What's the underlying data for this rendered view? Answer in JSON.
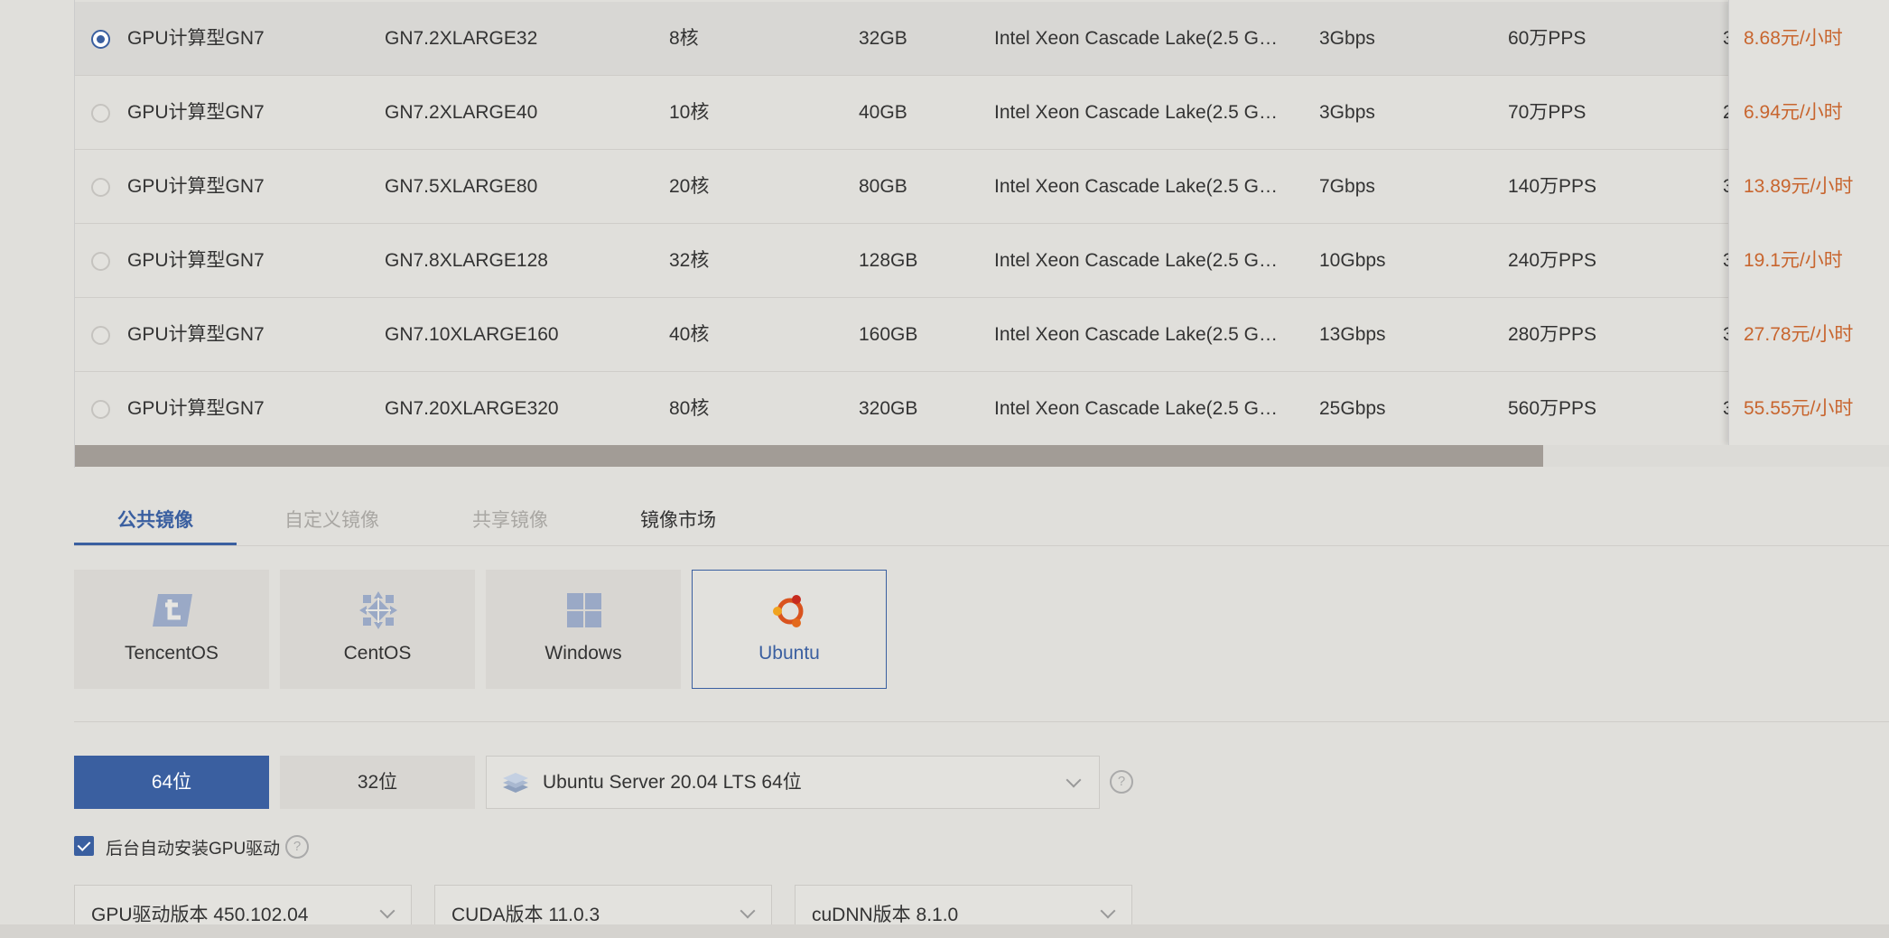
{
  "instances": [
    {
      "type": "GPU计算型GN7",
      "spec": "GN7.2XLARGE32",
      "cpu": "8核",
      "memory": "32GB",
      "processor": "Intel Xeon Cascade Lake(2.5 G…",
      "bandwidth": "3Gbps",
      "pps": "60万PPS",
      "peek": "3",
      "price": "8.68元/小时",
      "selected": true
    },
    {
      "type": "GPU计算型GN7",
      "spec": "GN7.2XLARGE40",
      "cpu": "10核",
      "memory": "40GB",
      "processor": "Intel Xeon Cascade Lake(2.5 G…",
      "bandwidth": "3Gbps",
      "pps": "70万PPS",
      "peek": "2",
      "price": "6.94元/小时",
      "selected": false
    },
    {
      "type": "GPU计算型GN7",
      "spec": "GN7.5XLARGE80",
      "cpu": "20核",
      "memory": "80GB",
      "processor": "Intel Xeon Cascade Lake(2.5 G…",
      "bandwidth": "7Gbps",
      "pps": "140万PPS",
      "peek": "3",
      "price": "13.89元/小时",
      "selected": false
    },
    {
      "type": "GPU计算型GN7",
      "spec": "GN7.8XLARGE128",
      "cpu": "32核",
      "memory": "128GB",
      "processor": "Intel Xeon Cascade Lake(2.5 G…",
      "bandwidth": "10Gbps",
      "pps": "240万PPS",
      "peek": "3",
      "price": "19.1元/小时",
      "selected": false
    },
    {
      "type": "GPU计算型GN7",
      "spec": "GN7.10XLARGE160",
      "cpu": "40核",
      "memory": "160GB",
      "processor": "Intel Xeon Cascade Lake(2.5 G…",
      "bandwidth": "13Gbps",
      "pps": "280万PPS",
      "peek": "3",
      "price": "27.78元/小时",
      "selected": false
    },
    {
      "type": "GPU计算型GN7",
      "spec": "GN7.20XLARGE320",
      "cpu": "80核",
      "memory": "320GB",
      "processor": "Intel Xeon Cascade Lake(2.5 G…",
      "bandwidth": "25Gbps",
      "pps": "560万PPS",
      "peek": "3",
      "price": "55.55元/小时",
      "selected": false
    }
  ],
  "image_tabs": [
    "公共镜像",
    "自定义镜像",
    "共享镜像",
    "镜像市场"
  ],
  "os_options": [
    {
      "label": "TencentOS",
      "icon": "tencentos-icon"
    },
    {
      "label": "CentOS",
      "icon": "centos-icon"
    },
    {
      "label": "Windows",
      "icon": "windows-icon"
    },
    {
      "label": "Ubuntu",
      "icon": "ubuntu-icon"
    }
  ],
  "selected_os": "Ubuntu",
  "bits": {
    "bit64": "64位",
    "bit32": "32位",
    "active": "64位"
  },
  "os_version": "Ubuntu Server 20.04 LTS 64位",
  "gpu_driver_auto_install": {
    "label": "后台自动安装GPU驱动",
    "checked": true
  },
  "help_icon": "?",
  "driver": {
    "gpu_driver": "GPU驱动版本 450.102.04",
    "cuda": "CUDA版本 11.0.3",
    "cudnn": "cuDNN版本 8.1.0"
  },
  "colors": {
    "accent": "#3a5fa0",
    "price": "#c8652e",
    "background": "#e0dfdb"
  }
}
